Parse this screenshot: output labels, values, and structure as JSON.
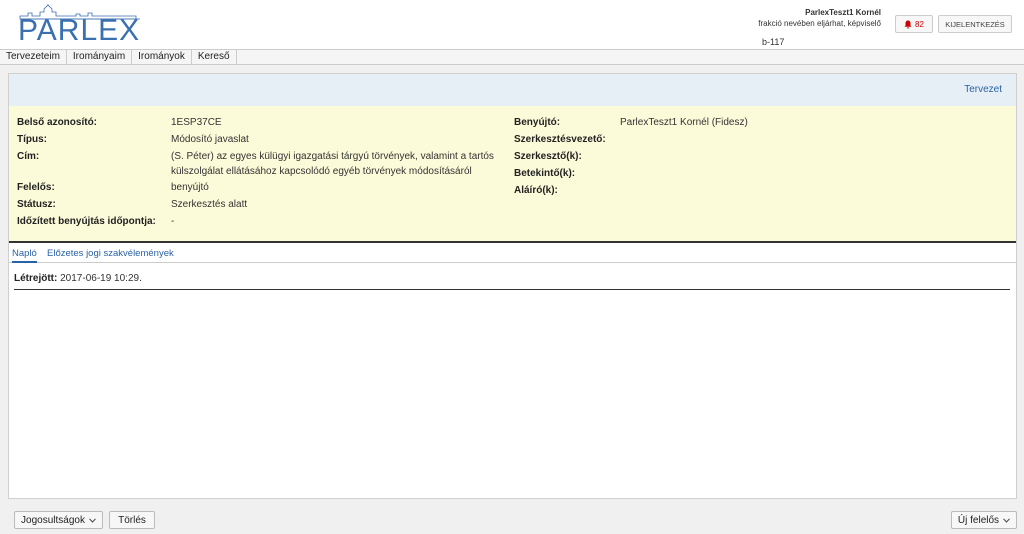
{
  "header": {
    "logo_text": "PARLEX",
    "user_name": "ParlexTeszt1 Kornél",
    "user_role": "frakció nevében eljárhat, képviselő",
    "session_id": "b-117",
    "notification_count": "82",
    "logout_label": "KIJELENTKEZÉS"
  },
  "menu": {
    "items": [
      "Tervezeteim",
      "Irományaim",
      "Irományok",
      "Kereső"
    ]
  },
  "panel": {
    "header_link": "Tervezet",
    "left": [
      {
        "label": "Belső azonosító:",
        "value": "1ESP37CE"
      },
      {
        "label": "Típus:",
        "value": "Módosító javaslat"
      },
      {
        "label": "Cím:",
        "value": "(S. Péter) az egyes külügyi igazgatási tárgyú törvények, valamint a tartós"
      },
      {
        "label": "",
        "value": "külszolgálat ellátásához kapcsolódó egyéb törvények módosításáról"
      },
      {
        "label": "Felelős:",
        "value": "benyújtó"
      },
      {
        "label": "Státusz:",
        "value": "Szerkesztés alatt"
      },
      {
        "label": "Időzített benyújtás időpontja:",
        "value": "-"
      }
    ],
    "right": [
      {
        "label": "Benyújtó:",
        "value": "ParlexTeszt1 Kornél (Fidesz)"
      },
      {
        "label": "Szerkesztésvezető:",
        "value": ""
      },
      {
        "label": "Szerkesztő(k):",
        "value": ""
      },
      {
        "label": "Betekintő(k):",
        "value": ""
      },
      {
        "label": "Aláíró(k):",
        "value": ""
      }
    ]
  },
  "tabs": [
    {
      "label": "Napló",
      "active": true
    },
    {
      "label": "Előzetes jogi szakvélemények",
      "active": false
    }
  ],
  "log": {
    "label": "Létrejött:",
    "value": "2017-06-19 10:29."
  },
  "footer": {
    "permissions_label": "Jogosultságok",
    "delete_label": "Törlés",
    "new_responsible_label": "Új felelős"
  },
  "colors": {
    "brand": "#3a6fb0",
    "info_bg": "#fcfbd9",
    "panel_header_bg": "#e6eff6",
    "link": "#2a62a8",
    "alert": "#cc0000"
  }
}
